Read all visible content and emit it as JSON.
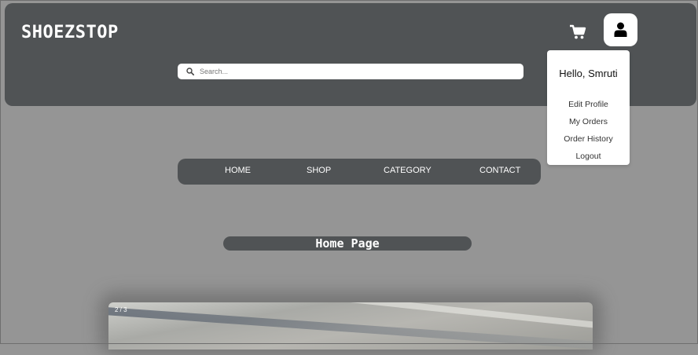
{
  "header": {
    "brand": "SHOEZSTOP",
    "search": {
      "placeholder": "Search...",
      "value": ""
    }
  },
  "user_menu": {
    "greeting": "Hello, Smruti",
    "items": [
      {
        "label": "Edit Profile"
      },
      {
        "label": "My Orders"
      },
      {
        "label": "Order History"
      },
      {
        "label": "Logout"
      }
    ]
  },
  "nav": {
    "items": [
      {
        "label": "HOME"
      },
      {
        "label": "SHOP"
      },
      {
        "label": "CATEGORY"
      },
      {
        "label": "CONTACT"
      }
    ]
  },
  "page_title": "Home Page",
  "slider": {
    "counter": "2 / 3"
  },
  "icons": {
    "cart": "cart-icon",
    "user": "user-icon",
    "search": "search-icon"
  },
  "colors": {
    "header_bg": "#505355",
    "page_bg": "#959595",
    "text_light": "#ffffff"
  }
}
